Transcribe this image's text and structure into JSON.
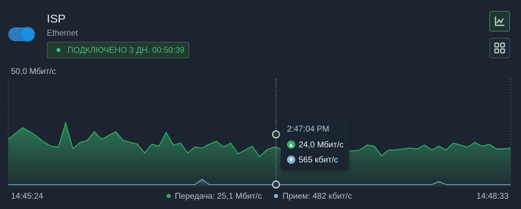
{
  "header": {
    "title": "ISP",
    "subtitle": "Ethernet",
    "status": "ПОДКЛЮЧЕНО 3 ДН. 00:50:39"
  },
  "colors": {
    "upload": "#2fb36a",
    "download": "#7fb6dd",
    "status": "#43b87a",
    "toggle": "#1a8ee0"
  },
  "icons": {
    "chart_button": "chart-icon",
    "grid_button": "grid-icon"
  },
  "chart_data": {
    "type": "area",
    "y_axis_max_label": "50,0 Мбит/с",
    "ylim": [
      0,
      50
    ],
    "x_start_label": "14:45:24",
    "x_end_label": "14:48:33",
    "series": [
      {
        "name": "Передача",
        "values": [
          21.7,
          24.4,
          27.1,
          25.3,
          23.0,
          20.3,
          18.5,
          18.1,
          29.4,
          17.2,
          20.3,
          21.2,
          25.3,
          21.7,
          23.5,
          25.3,
          21.2,
          20.3,
          19.4,
          15.3,
          19.4,
          18.5,
          24.9,
          19.0,
          19.9,
          15.3,
          18.1,
          17.6,
          19.4,
          20.8,
          18.1,
          19.9,
          14.9,
          16.7,
          18.5,
          13.5,
          16.7,
          18.1,
          17.2,
          16.3,
          15.3,
          15.3,
          14.0,
          19.4,
          19.4,
          18.1,
          20.8,
          16.3,
          16.3,
          16.7,
          19.0,
          18.5,
          14.0,
          16.7,
          16.7,
          17.2,
          17.6,
          17.2,
          19.0,
          16.7,
          18.5,
          16.7,
          19.9,
          19.0,
          18.1,
          20.3,
          18.5,
          19.4,
          17.2,
          17.2,
          17.6
        ]
      },
      {
        "name": "Прием",
        "values": [
          0.5,
          0.5,
          0.5,
          0.5,
          0.5,
          0.5,
          0.5,
          0.5,
          0.5,
          0.5,
          0.5,
          0.5,
          0.5,
          0.5,
          0.5,
          0.5,
          0.5,
          0.5,
          0.5,
          0.5,
          0.5,
          0.5,
          0.5,
          0.5,
          0.5,
          0.5,
          0.5,
          3.0,
          0.5,
          0.5,
          0.5,
          0.5,
          0.5,
          0.5,
          0.5,
          0.5,
          0.5,
          0.5,
          0.5,
          0.5,
          0.5,
          0.5,
          0.5,
          0.5,
          0.5,
          0.5,
          0.5,
          0.5,
          0.5,
          0.5,
          0.5,
          0.5,
          0.5,
          0.5,
          0.5,
          0.5,
          0.5,
          0.5,
          0.5,
          0.5,
          2.0,
          0.5,
          0.5,
          0.5,
          0.5,
          0.5,
          0.5,
          0.5,
          0.5,
          0.5,
          0.5
        ]
      }
    ],
    "legend": [
      {
        "label": "Передача: 25,1 Мбит/с",
        "color": "#2fb36a"
      },
      {
        "label": "Прием: 482 кбит/с",
        "color": "#7fb6dd"
      }
    ],
    "tooltip": {
      "time": "2:47:04 PM",
      "upload": "24,0 Мбит/с",
      "download": "565 кбит/с",
      "x_fraction": 0.533
    }
  }
}
